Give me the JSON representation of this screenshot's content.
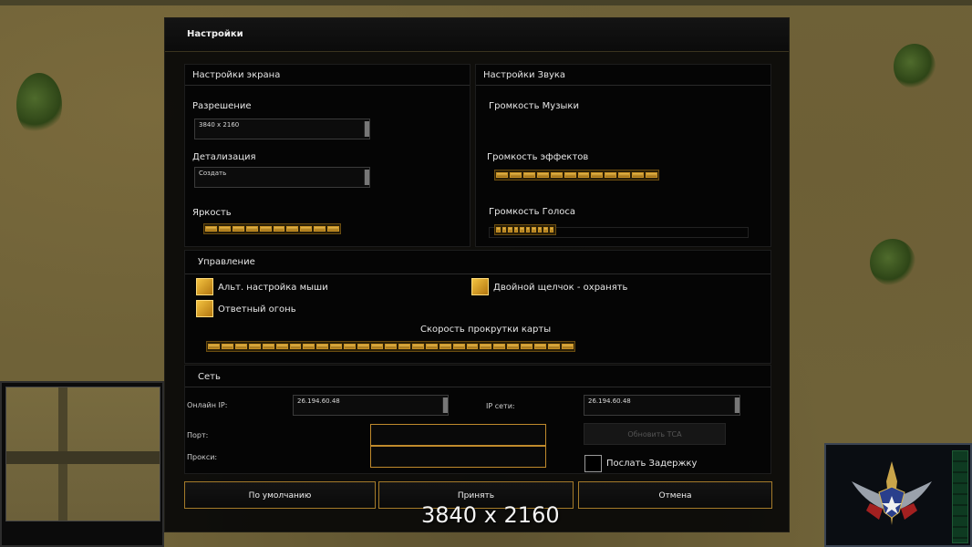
{
  "dialog": {
    "title": "Настройки"
  },
  "screen": {
    "title": "Настройки экрана",
    "resolution_label": "Разрешение",
    "resolution_value": "3840 x 2160",
    "detail_label": "Детализация",
    "detail_value": "Создать",
    "brightness_label": "Яркость",
    "brightness_level": 1.0
  },
  "sound": {
    "title": "Настройки Звука",
    "music_label": "Громкость Музыки",
    "effects_label": "Громкость эффектов",
    "effects_level": 1.0,
    "voice_label": "Громкость Голоса",
    "voice_level": 0.48
  },
  "controls": {
    "title": "Управление",
    "alt_mouse_label": "Альт. настройка мыши",
    "double_click_label": "Двойной щелчок - охранять",
    "return_fire_label": "Ответный огонь",
    "scroll_speed_label": "Скорость прокрутки карты",
    "scroll_speed_level": 1.0
  },
  "network": {
    "title": "Сеть",
    "online_ip_label": "Онлайн IP:",
    "online_ip_value": "26.194.60.48",
    "lan_ip_label": "IP сети:",
    "lan_ip_value": "26.194.60.48",
    "port_label": "Порт:",
    "proxy_label": "Прокси:",
    "refresh_button": "Обновить ТСА",
    "send_delay_label": "Послать Задержку"
  },
  "buttons": {
    "defaults": "По умолчанию",
    "accept": "Принять",
    "cancel": "Отмена"
  },
  "overlay": {
    "resolution_text": "3840 x 2160"
  },
  "colors": {
    "accent": "#c08a2c",
    "slider_fill": "#e8b84a"
  }
}
